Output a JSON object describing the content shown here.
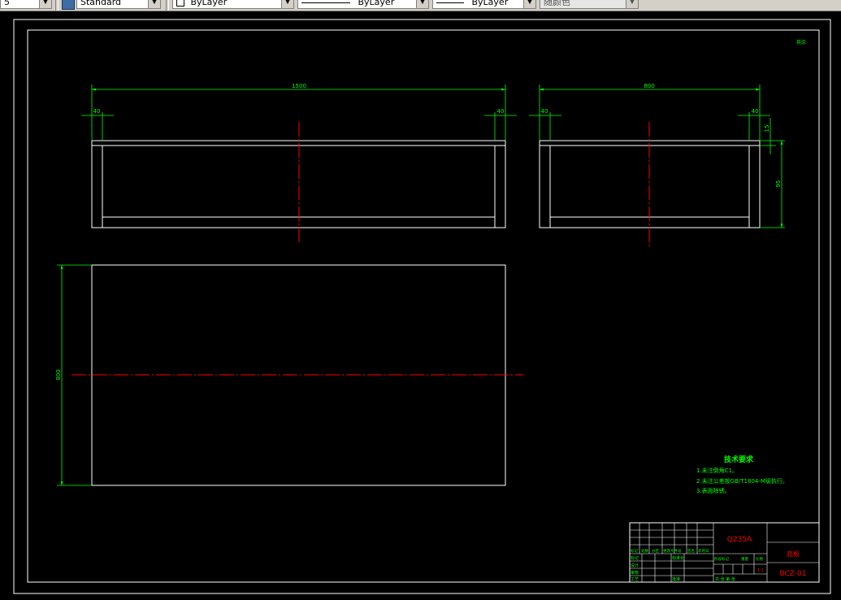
{
  "toolbar": {
    "dim_style_value": "Standard",
    "layer_value": "ByLayer",
    "linetype_value": "ByLayer",
    "lineweight_value": "ByLayer",
    "color_value": "随颜色",
    "partial_left": "5"
  },
  "drawing": {
    "top_right_mark": "其余",
    "front_view": {
      "width_dim": "1500",
      "left_inset_dim": "40",
      "right_inset_dim": "40"
    },
    "side_view": {
      "width_dim": "800",
      "left_inset_dim": "40",
      "right_inset_dim": "40",
      "top_dim": "15",
      "height_dim": "95"
    },
    "plan_view": {
      "height_dim": "800"
    },
    "notes": {
      "title": "技术要求",
      "line1": "1.未注倒角C1。",
      "line2": "2.未注公差按GB/T1804-M级执行。",
      "line3": "3.表面除锈。"
    },
    "title_block": {
      "material": "Q235A",
      "part_name": "底板",
      "drawing_number": "BCZ-01",
      "scale": "1:1",
      "row_labels": [
        "标记",
        "设计",
        "审核",
        "工艺"
      ],
      "header_labels": [
        "标记",
        "处数",
        "分区",
        "更改文件号",
        "签名",
        "年月日"
      ],
      "std_label": "标准化",
      "approve_label": "批准",
      "stage_labels": [
        "阶段标记",
        "重量",
        "比例"
      ],
      "sheet_label": "共 张 第 张"
    }
  },
  "colors": {
    "dim": "#00ff00",
    "geometry": "#ffffff",
    "centerline": "#ff0000"
  }
}
